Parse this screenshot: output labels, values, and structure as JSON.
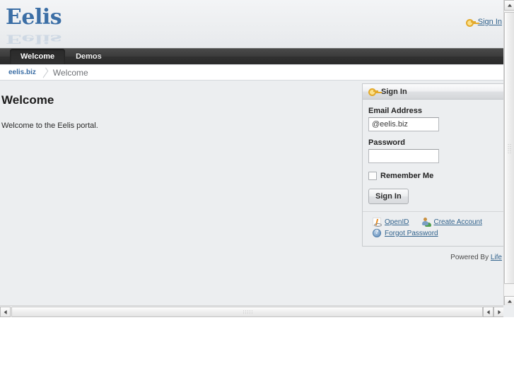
{
  "header": {
    "logo_text": "Eelis",
    "signin_label": "Sign In",
    "signin_icon": "key-icon"
  },
  "nav": {
    "tabs": [
      {
        "label": "Welcome",
        "selected": true
      },
      {
        "label": "Demos",
        "selected": false
      }
    ]
  },
  "breadcrumb": {
    "home": "eelis.biz",
    "current": "Welcome"
  },
  "main": {
    "title": "Welcome",
    "intro": "Welcome to the Eelis portal."
  },
  "signin_portlet": {
    "title": "Sign In",
    "title_icon": "key-icon",
    "email_label": "Email Address",
    "email_value": "@eelis.biz",
    "email_placeholder": "",
    "password_label": "Password",
    "password_value": "",
    "remember_label": "Remember Me",
    "submit_label": "Sign In",
    "links": [
      {
        "label": "OpenID",
        "icon": "openid-icon"
      },
      {
        "label": "Create Account",
        "icon": "user-add-icon"
      },
      {
        "label": "Forgot Password",
        "icon": "help-icon"
      }
    ]
  },
  "footer": {
    "powered_by": "Powered By",
    "powered_link": "Life"
  },
  "colors": {
    "page_bg": "#eceef0",
    "nav_bg": "#313131",
    "link": "#31628c",
    "logo": "#3b6ea5"
  }
}
